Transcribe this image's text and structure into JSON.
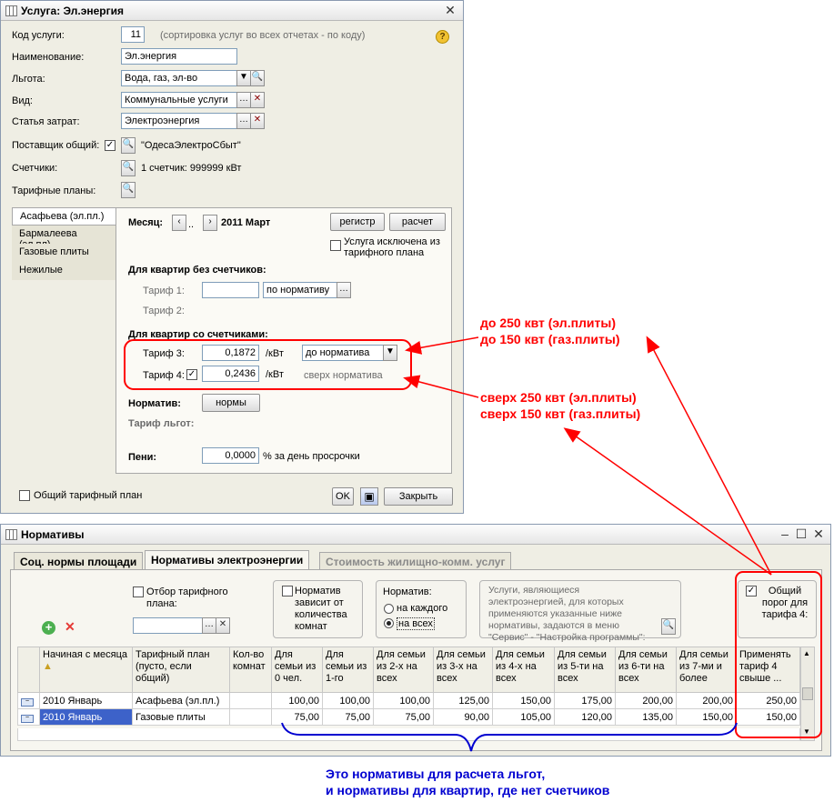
{
  "service_window": {
    "title": "Услуга: Эл.энергия",
    "code_label": "Код услуги:",
    "code_value": "11",
    "code_hint": "(сортировка услуг во всех отчетах - по коду)",
    "name_label": "Наименование:",
    "name_value": "Эл.энергия",
    "benefit_label": "Льгота:",
    "benefit_value": "Вода, газ, эл-во",
    "type_label": "Вид:",
    "type_value": "Коммунальные услуги",
    "cost_label": "Статья затрат:",
    "cost_value": "Электроэнергия",
    "supplier_label": "Поставщик общий:",
    "supplier_value": "\"ОдесаЭлектроСбыт\"",
    "meters_label": "Счетчики:",
    "meters_value": "1 счетчик: 999999 кВт",
    "tariff_plans_label": "Тарифные планы:",
    "plans": [
      "Асафьева (эл.пл.)",
      "Бармалеева (эл.пл)",
      "Газовые плиты",
      "Нежилые"
    ],
    "month_label": "Месяц:",
    "month_value": "2011 Март",
    "register_button": "регистр",
    "calc_button": "расчет",
    "excluded_label": "Услуга исключена из тарифного плана",
    "no_meters_header": "Для квартир без счетчиков:",
    "tariff1_label": "Тариф 1:",
    "tariff1_mode": "по нормативу",
    "tariff2_label": "Тариф 2:",
    "with_meters_header": "Для квартир со счетчиками:",
    "tariff3_label": "Тариф 3:",
    "tariff3_value": "0,1872",
    "tariff3_unit": "/кВт",
    "tariff3_mode": "до норматива",
    "tariff4_label": "Тариф 4:",
    "tariff4_value": "0,2436",
    "tariff4_unit": "/кВт",
    "tariff4_mode": "сверх норматива",
    "norm_label": "Норматив:",
    "norms_button": "нормы",
    "benefit_tariff_label": "Тариф льгот:",
    "penalty_label": "Пени:",
    "penalty_value": "0,0000",
    "penalty_unit": "% за день просрочки",
    "common_plan_label": "Общий тарифный план",
    "ok_button": "OK",
    "close_button": "Закрыть"
  },
  "norms_window": {
    "title": "Нормативы",
    "tabs": [
      "Соц. нормы площади",
      "Нормативы  электроэнергии",
      "Стоимость жилищно-комм. услуг"
    ],
    "filter_label": "Отбор тарифного плана:",
    "depends_label": "Норматив зависит от количества комнат",
    "norm_group_label": "Норматив:",
    "radio_each": "на каждого",
    "radio_all": "на всех",
    "info_text": "Услуги,  являющиеся электроэнергией, для которых  применяются  указанные ниже нормативы, задаются в меню \"Сервис\" - \"Настройка программы\":",
    "threshold_label": "Общий порог для тарифа 4:",
    "columns": [
      "Начиная с месяца",
      "Тарифный план (пусто, если общий)",
      "Кол-во комнат",
      "Для семьи из 0 чел.",
      "Для семьи из 1-го",
      "Для семьи из 2-х на всех",
      "Для семьи из 3-х на всех",
      "Для семьи из 4-х на всех",
      "Для семьи из 5-ти на всех",
      "Для семьи из 6-ти на всех",
      "Для семьи из 7-ми и более",
      "Применять тариф 4 свыше ..."
    ],
    "rows": [
      [
        "2010 Январь",
        "Асафьева (эл.пл.)",
        "",
        "100,00",
        "100,00",
        "100,00",
        "125,00",
        "150,00",
        "175,00",
        "200,00",
        "200,00",
        "250,00"
      ],
      [
        "2010 Январь",
        "Газовые плиты",
        "",
        "75,00",
        "75,00",
        "75,00",
        "90,00",
        "105,00",
        "120,00",
        "135,00",
        "150,00",
        "150,00"
      ]
    ]
  },
  "annotations": {
    "red1_line1": "до 250 квт (эл.плиты)",
    "red1_line2": "до 150 квт (газ.плиты)",
    "red2_line1": "сверх 250 квт (эл.плиты)",
    "red2_line2": "сверх 150 квт (газ.плиты)",
    "blue_line1": "Это нормативы для расчета льгот,",
    "blue_line2": "и нормативы для квартир, где нет счетчиков"
  },
  "colors": {
    "annotation_red": "#ff0000",
    "annotation_blue": "#0000d0",
    "selected_cell": "#3d62c9"
  }
}
